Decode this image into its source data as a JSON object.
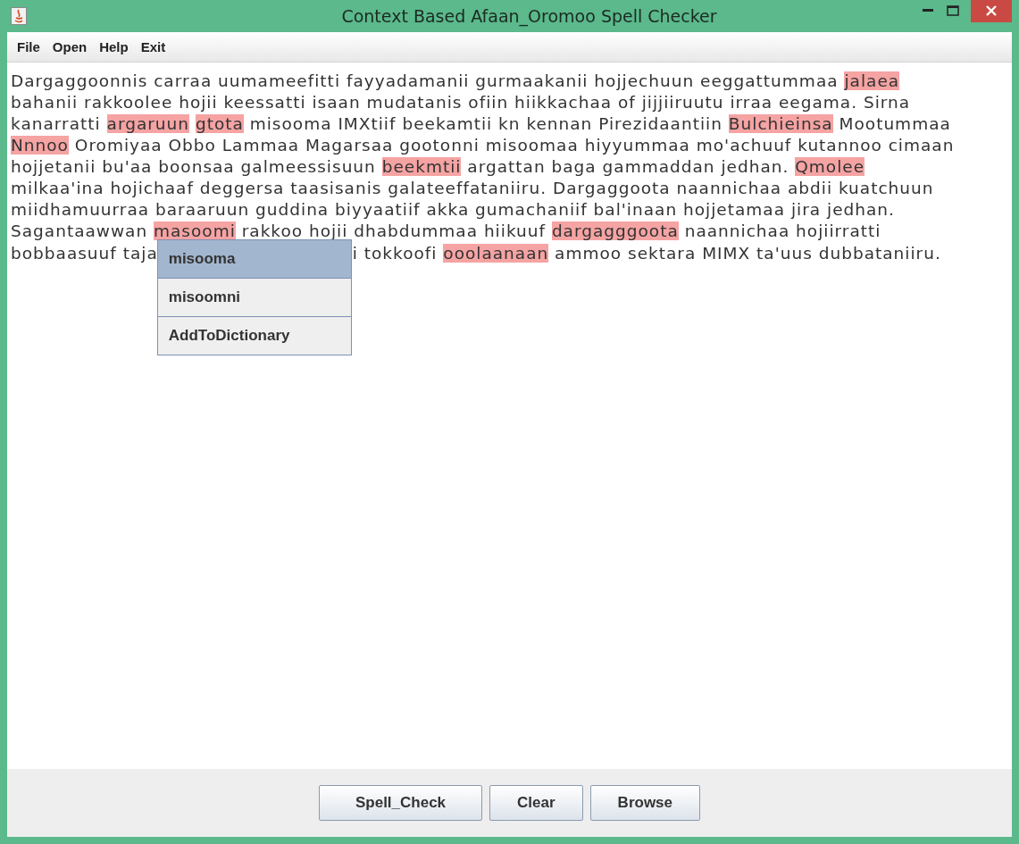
{
  "window": {
    "title": "Context Based Afaan_Oromoo Spell Checker",
    "controls": [
      {
        "kind": "minimize"
      },
      {
        "kind": "maximize"
      },
      {
        "kind": "close"
      }
    ]
  },
  "menu": [
    "File",
    "Open",
    "Help",
    "Exit"
  ],
  "editor": {
    "lines": [
      [
        {
          "text": "Dargaggoonnis carraa uumameefitti fayyadamanii gurmaakanii hojjechuun eeggattummaa ",
          "misspelled": false
        },
        {
          "text": "jalaea",
          "misspelled": true
        }
      ],
      [
        {
          "text": "bahanii rakkoolee hojii keessatti isaan mudatanis ofiin hiikkachaa of jijjiiruutu irraa eegama. Sirna",
          "misspelled": false
        }
      ],
      [
        {
          "text": "kanarratti ",
          "misspelled": false
        },
        {
          "text": "argaruun",
          "misspelled": true
        },
        {
          "text": "gtota",
          "misspelled": true
        },
        {
          "text": " misooma IMXtiif beekamtii kn kennan Pirezidaantiin ",
          "misspelled": false
        },
        {
          "text": "Bulchieinsa",
          "misspelled": true
        },
        {
          "text": " Mootummaa",
          "misspelled": false
        }
      ],
      [
        {
          "text": "Nnnoo",
          "misspelled": true
        },
        {
          "text": " Oromiyaa Obbo Lammaa Magarsaa gootonni misoomaa hiyyummaa mo'achuuf kutannoo cimaan",
          "misspelled": false
        }
      ],
      [
        {
          "text": "hojjetanii bu'aa boonsaa galmeessisuun ",
          "misspelled": false
        },
        {
          "text": "beekmtii",
          "misspelled": true
        },
        {
          "text": " argattan baga gammaddan jedhan. ",
          "misspelled": false
        },
        {
          "text": "Qmolee",
          "misspelled": true
        }
      ],
      [
        {
          "text": "milkaa'ina hojichaaf deggersa taasisanis galateeffataniiru. Dargaggoota naannichaa abdii kuatchuun",
          "misspelled": false
        }
      ],
      [
        {
          "text": "miidhamuurraa baraaruun guddina biyyaatiif akka gumachaniif bal'inaan hojjetamaa jira jedhan.",
          "misspelled": false
        }
      ],
      [
        {
          "text": "Sagantaawwan ",
          "misspelled": false
        },
        {
          "text": "masoomi",
          "misspelled": true
        },
        {
          "text": " rakkoo hojii dhabdummaa hiikuuf ",
          "misspelled": false
        },
        {
          "text": "dargagggoota",
          "misspelled": true
        },
        {
          "text": " naannichaa hojiirratti",
          "misspelled": false
        }
      ],
      [
        {
          "text": "bobbaasuuf taja",
          "misspelled": false
        },
        {
          "kind": "popup"
        },
        {
          "text": "i tokkoofi ",
          "misspelled": false
        },
        {
          "text": "ooolaanaan",
          "misspelled": true
        },
        {
          "text": " ammoo sektara MIMX ta'uus dubbataniiru.",
          "misspelled": false
        }
      ]
    ]
  },
  "suggestions": [
    {
      "label": "misooma",
      "selected": true
    },
    {
      "label": "misoomni",
      "selected": false
    },
    {
      "label": "AddToDictionary",
      "selected": false
    }
  ],
  "buttons": [
    "Spell_Check",
    "Clear",
    "Browse"
  ]
}
